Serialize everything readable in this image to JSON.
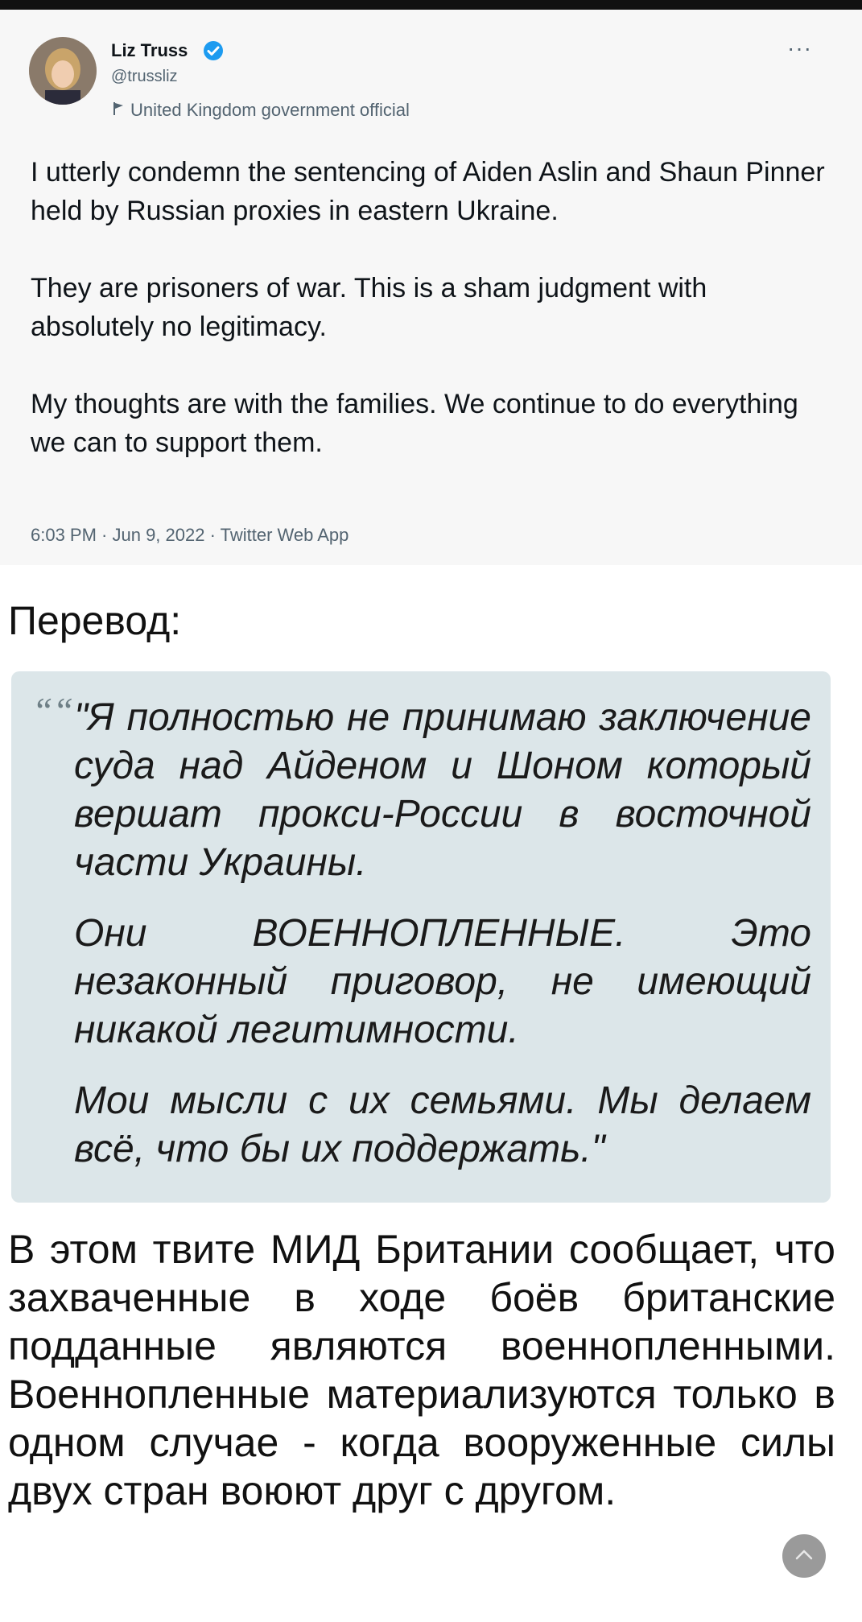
{
  "tweet": {
    "author_name": "Liz Truss",
    "handle": "@trussliz",
    "gov_label": "United Kingdom government official",
    "more_label": "···",
    "paragraphs": [
      "I utterly condemn the sentencing of Aiden Aslin and Shaun Pinner held by Russian proxies in eastern Ukraine.",
      "They are prisoners of war. This is a sham judgment with absolutely no legitimacy.",
      "My thoughts are with the families. We continue to do everything we can to support them."
    ],
    "meta": "6:03 PM · Jun 9, 2022 · Twitter Web App"
  },
  "section_title": "Перевод:",
  "quote": {
    "mark": "““",
    "paragraphs": [
      "\"Я полностью не принимаю заключение суда над Айденом и Шоном который вершат прокси-России в восточной части Украины.",
      "Они ВОЕННОПЛЕННЫЕ. Это незаконный приговор, не имеющий никакой легитимности.",
      "Мои мысли с их семьями. Мы делаем всё, что бы их поддержать.\""
    ]
  },
  "body_text": "В этом твите МИД Британии сообщает, что захваченные в ходе боёв британские подданные являются военнопленными. Военнопленные материализуются только в одном случае - когда вооруженные силы двух стран воюют друг с другом.",
  "colors": {
    "verified": "#1d9bf0",
    "quote_bg": "#dce6e9",
    "tweet_bg": "#f7f7f7"
  },
  "icons": [
    "verified-badge-icon",
    "flag-icon",
    "more-icon",
    "chevron-up-icon"
  ]
}
